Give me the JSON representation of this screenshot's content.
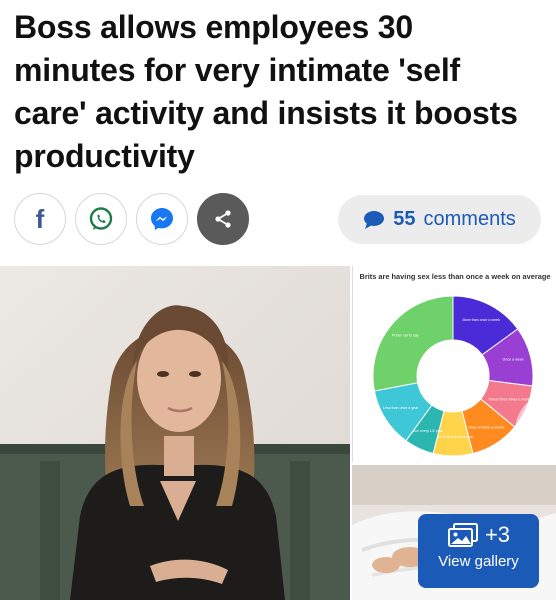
{
  "article": {
    "headline": "Boss allows employees 30 minutes for very intimate 'self care' activity and insists it boosts productivity"
  },
  "share": {
    "facebook_glyph": "f",
    "comment_count": "55",
    "comment_word": "comments"
  },
  "gallery": {
    "count": "+3",
    "label": "View gallery"
  },
  "chart_data": {
    "type": "pie",
    "title": "Brits are having sex less than once a week on average",
    "categories": [
      "More than once a week",
      "Once a week",
      "Twice/ three times a month",
      "Once or twice a month",
      "Twice to four times a year",
      "Once every 1/2 year",
      "Less than once a year",
      "Prefer not to say"
    ],
    "values": [
      15,
      12,
      9,
      10,
      8,
      6,
      12,
      28
    ],
    "colors": [
      "#4b2bd8",
      "#9a3fd4",
      "#f27a8c",
      "#ff8a1f",
      "#ffd34a",
      "#2bb6b0",
      "#3ec7d6",
      "#6fd16a"
    ]
  }
}
